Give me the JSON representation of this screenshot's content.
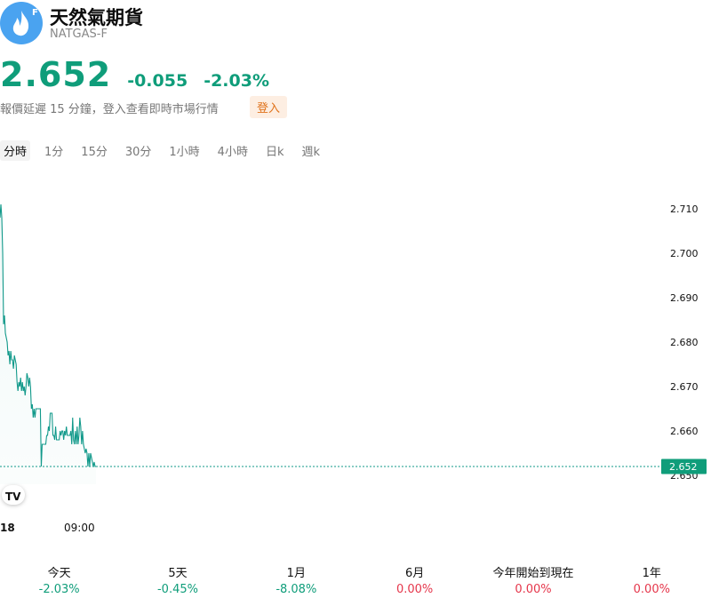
{
  "header": {
    "title": "天然氣期貨",
    "symbol": "NATGAS-F",
    "logo_letter": "F"
  },
  "quote": {
    "price": "2.652",
    "change": "-0.055",
    "change_percent": "-2.03%"
  },
  "notice": {
    "text": "報價延遲 15 分鐘，登入查看即時市場行情",
    "login_label": "登入"
  },
  "tabs": [
    {
      "label": "分時",
      "active": true
    },
    {
      "label": "1分"
    },
    {
      "label": "15分"
    },
    {
      "label": "30分"
    },
    {
      "label": "1小時"
    },
    {
      "label": "4小時"
    },
    {
      "label": "日k"
    },
    {
      "label": "週k"
    }
  ],
  "chart_data": {
    "type": "line",
    "y_ticks": [
      "2.710",
      "2.700",
      "2.690",
      "2.680",
      "2.670",
      "2.660",
      "2.650"
    ],
    "x_ticks": [
      "18",
      "09:00"
    ],
    "current_value_label": "2.652",
    "watermark": "TV",
    "ylim": [
      2.6458,
      2.713
    ],
    "series": [
      {
        "color": "#11998a",
        "values": [
          2.708,
          2.711,
          2.708,
          2.7,
          2.684,
          2.686,
          2.682,
          2.681,
          2.68,
          2.677,
          2.678,
          2.675,
          2.678,
          2.676,
          2.676,
          2.674,
          2.677,
          2.676,
          2.675,
          2.671,
          2.669,
          2.671,
          2.67,
          2.672,
          2.669,
          2.671,
          2.669,
          2.67,
          2.668,
          2.67,
          2.673,
          2.672,
          2.67,
          2.672,
          2.67,
          2.665,
          2.666,
          2.663,
          2.665,
          2.663,
          2.665,
          2.665,
          2.665,
          2.665,
          2.665,
          2.665,
          2.652,
          2.657,
          2.657,
          2.657,
          2.657,
          2.657,
          2.659,
          2.659,
          2.661,
          2.66,
          2.664,
          2.664,
          2.664,
          2.659,
          2.659,
          2.658,
          2.661,
          2.658,
          2.658,
          2.658,
          2.658,
          2.66,
          2.659,
          2.66,
          2.66,
          2.658,
          2.66,
          2.659,
          2.661,
          2.659,
          2.659,
          2.659,
          2.659,
          2.66,
          2.657,
          2.663,
          2.658,
          2.657,
          2.66,
          2.657,
          2.661,
          2.657,
          2.659,
          2.663,
          2.661,
          2.657,
          2.66,
          2.657,
          2.656,
          2.655,
          2.656,
          2.655,
          2.652,
          2.655,
          2.652,
          2.655,
          2.654,
          2.653,
          2.652,
          2.653,
          2.652,
          2.652
        ]
      }
    ]
  },
  "performance": [
    {
      "label": "今天",
      "value": "-2.03%",
      "color": "#0f9d7a"
    },
    {
      "label": "5天",
      "value": "-0.45%",
      "color": "#0f9d7a"
    },
    {
      "label": "1月",
      "value": "-8.08%",
      "color": "#0f9d7a"
    },
    {
      "label": "6月",
      "value": "0.00%",
      "color": "#e5364b"
    },
    {
      "label": "今年開始到現在",
      "value": "0.00%",
      "color": "#e5364b"
    },
    {
      "label": "1年",
      "value": "0.00%",
      "color": "#e5364b"
    }
  ]
}
